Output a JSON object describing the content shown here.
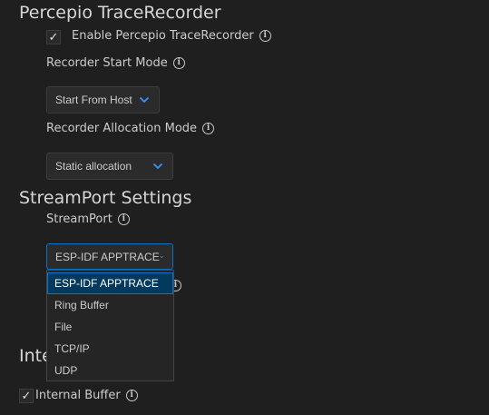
{
  "sections": {
    "percepio": {
      "title": "Percepio TraceRecorder",
      "enable_label": "Enable Percepio TraceRecorder",
      "enable_checked": true,
      "start_mode_label": "Recorder Start Mode",
      "start_mode_value": "Start From Host",
      "allocation_mode_label": "Recorder Allocation Mode",
      "allocation_mode_value": "Static allocation"
    },
    "streamport": {
      "title": "StreamPort Settings",
      "streamport_label": "StreamPort",
      "streamport_value": "ESP-IDF APPTRACE",
      "options": [
        "ESP-IDF APPTRACE",
        "Ring Buffer",
        "File",
        "TCP/IP",
        "UDP"
      ],
      "selected_index": 0
    },
    "internal": {
      "title_partial": "Inte",
      "internal_buffer_label": "Internal Buffer",
      "internal_buffer_checked": true
    }
  },
  "icons": {
    "checkmark": "✓",
    "info": "i"
  },
  "colors": {
    "background": "#1f1f1f",
    "accent": "#0e71c8",
    "selected_bg": "#04395e"
  }
}
